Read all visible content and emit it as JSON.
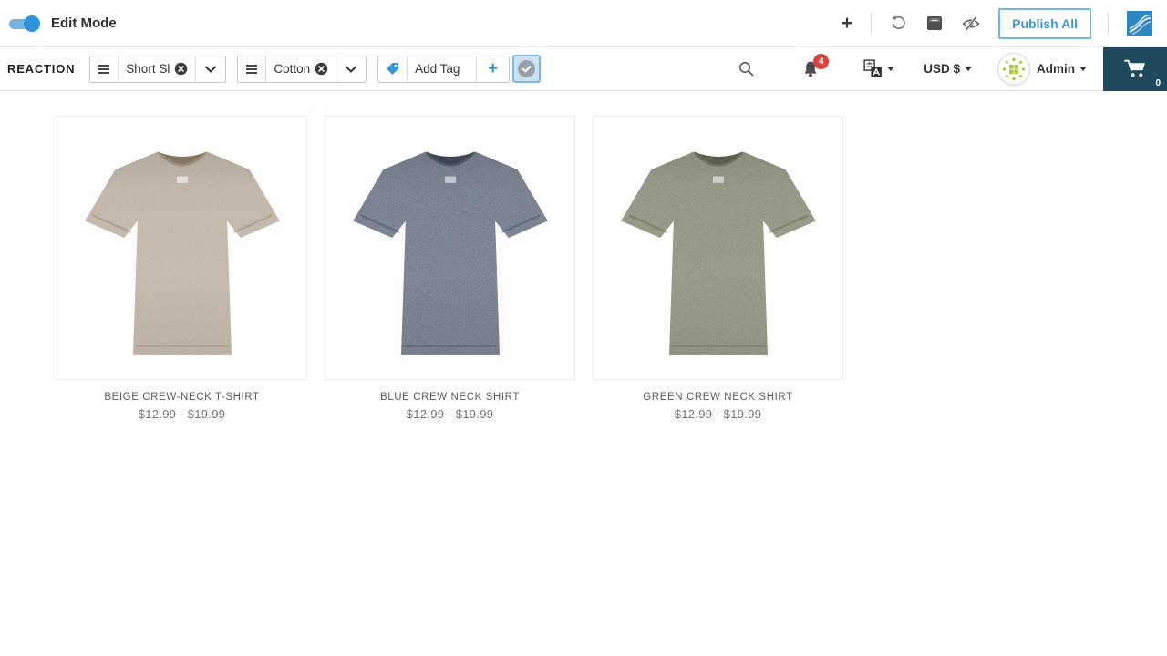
{
  "theme": {
    "accent_blue": "#3b99d4",
    "publish_border": "#6fb6e3",
    "cart_bg": "#1f4a5e",
    "badge_red": "#d9453c",
    "avatar_green": "#a9c83b",
    "logo_blue": "#2e86c1"
  },
  "header": {
    "edit_mode_label": "Edit Mode",
    "edit_mode_on": true,
    "publish_all_label": "Publish All"
  },
  "toolbar": {
    "collection_label": "REACTION",
    "filters": [
      {
        "label": "Short Sl"
      },
      {
        "label": "Cotton"
      }
    ],
    "add_tag_placeholder": "Add Tag",
    "notifications_count": "4",
    "currency_label": "USD $",
    "user_label": "Admin",
    "cart_count": "0"
  },
  "products": [
    {
      "title": "BEIGE CREW-NECK T-SHIRT",
      "price": "$12.99 - $19.99",
      "colors": {
        "base": "#b7a997",
        "dark": "#9c8d7a",
        "deep": "#857664"
      }
    },
    {
      "title": "BLUE CREW NECK SHIRT",
      "price": "$12.99 - $19.99",
      "colors": {
        "base": "#5b6577",
        "dark": "#4a5363",
        "deep": "#3d4452"
      }
    },
    {
      "title": "GREEN CREW NECK SHIRT",
      "price": "$12.99 - $19.99",
      "colors": {
        "base": "#7d8168",
        "dark": "#6a6e57",
        "deep": "#5a5e4a"
      }
    }
  ]
}
